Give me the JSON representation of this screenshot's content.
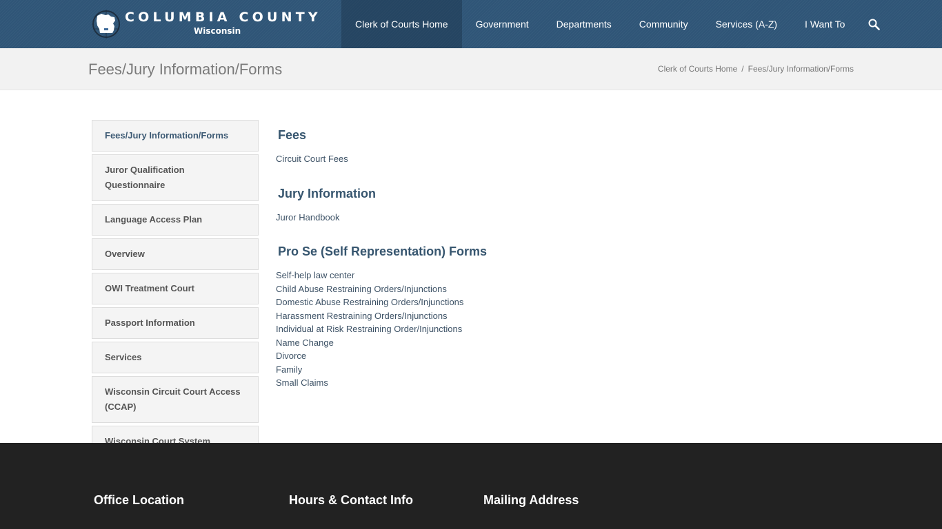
{
  "header": {
    "logo": {
      "title": "COLUMBIA COUNTY",
      "subtitle": "Wisconsin"
    },
    "nav": [
      {
        "label": "Clerk of Courts Home",
        "active": true
      },
      {
        "label": "Government",
        "active": false
      },
      {
        "label": "Departments",
        "active": false
      },
      {
        "label": "Community",
        "active": false
      },
      {
        "label": "Services (A-Z)",
        "active": false
      },
      {
        "label": "I Want To",
        "active": false
      }
    ],
    "search_icon": "search-icon",
    "colors": {
      "header_bg": "#2f5577"
    }
  },
  "title_band": {
    "page_title": "Fees/Jury Information/Forms",
    "breadcrumb": [
      {
        "label": "Clerk of Courts Home"
      },
      {
        "label": "Fees/Jury Information/Forms"
      }
    ],
    "separator": "/"
  },
  "sidebar": {
    "items": [
      {
        "label": "Fees/Jury Information/Forms",
        "active": true
      },
      {
        "label": "Juror Qualification Questionnaire",
        "active": false
      },
      {
        "label": "Language Access Plan",
        "active": false
      },
      {
        "label": "Overview",
        "active": false
      },
      {
        "label": "OWI Treatment Court",
        "active": false
      },
      {
        "label": "Passport Information",
        "active": false
      },
      {
        "label": "Services",
        "active": false
      },
      {
        "label": "Wisconsin Circuit Court Access (CCAP)",
        "active": false
      },
      {
        "label": "Wisconsin Court System",
        "active": false
      }
    ]
  },
  "main": {
    "sections": [
      {
        "heading": "Fees",
        "links": [
          "Circuit Court Fees"
        ]
      },
      {
        "heading": "Jury Information",
        "links": [
          "Juror Handbook"
        ]
      },
      {
        "heading": "Pro Se (Self Representation) Forms",
        "links": [
          "Self-help law center",
          "Child Abuse Restraining Orders/Injunctions",
          "Domestic Abuse Restraining Orders/Injunctions",
          "Harassment Restraining Orders/Injunctions",
          "Individual at Risk Restraining Order/Injunctions",
          "Name Change",
          "Divorce",
          "Family",
          "Small Claims"
        ]
      }
    ],
    "colors": {
      "heading": "#37566f",
      "link": "#3d5266"
    }
  },
  "footer": {
    "headings": [
      "Office Location",
      "Hours & Contact Info",
      "Mailing Address"
    ],
    "colors": {
      "bg": "#222222"
    }
  }
}
